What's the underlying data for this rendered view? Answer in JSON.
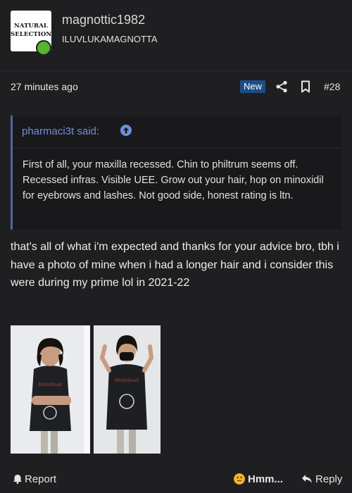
{
  "author": {
    "username": "magnottic1982",
    "user_title": "ILUVLUKAMAGNOTTA",
    "avatar_text": [
      "NATURAL",
      "SELECTION"
    ],
    "online_status": "online"
  },
  "post": {
    "timestamp": "27 minutes ago",
    "badge": "New",
    "number": "#28"
  },
  "quote": {
    "header": "pharmaci3t said:",
    "body": "First of all, your maxilla recessed. Chin to philtrum seems off. Recessed infras. Visible UEE. Grow out your hair, hop on minoxidil for eyebrows and lashes. Not good side, honest rating is ltn."
  },
  "message": "that's all of what i'm expected and thanks for your advice bro, tbh i have a photo of mine when i had a longer hair and i consider this were during my prime lol in 2021-22",
  "attachments": [
    {
      "name": "photo-arms-crossed"
    },
    {
      "name": "photo-hand-signs"
    }
  ],
  "actions": {
    "report": "Report",
    "reaction": "Hmm...",
    "reply": "Reply"
  },
  "colors": {
    "background": "#1f1f21",
    "link": "#6f8fd6",
    "badge": "#1e4d86",
    "online": "#57b52f"
  }
}
